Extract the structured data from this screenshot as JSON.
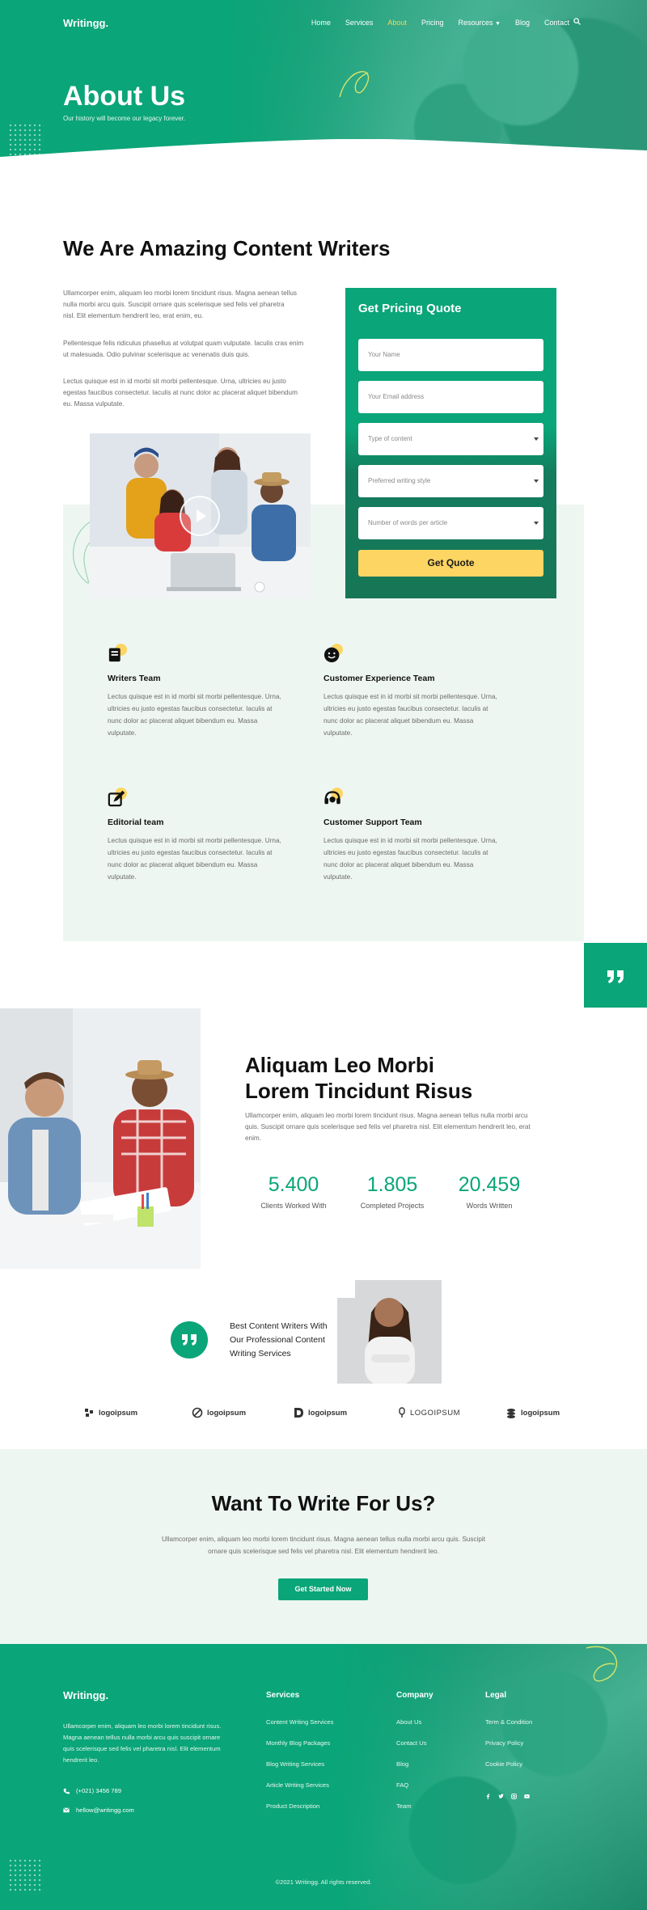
{
  "header": {
    "logo": "Writingg.",
    "nav": [
      {
        "label": "Home",
        "active": false
      },
      {
        "label": "Services",
        "active": false
      },
      {
        "label": "About",
        "active": true
      },
      {
        "label": "Pricing",
        "active": false
      },
      {
        "label": "Resources",
        "active": false,
        "dropdown": true
      },
      {
        "label": "Blog",
        "active": false
      },
      {
        "label": "Contact",
        "active": false
      }
    ],
    "search_icon": "search-icon"
  },
  "hero": {
    "title": "About Us",
    "subtitle": "Our history will become our legacy forever."
  },
  "intro": {
    "title": "We Are Amazing Content Writers",
    "paragraphs": [
      "Ullamcorper enim, aliquam leo morbi lorem tincidunt risus. Magna aenean tellus nulla morbi arcu quis. Suscipit ornare quis scelerisque sed felis vel pharetra nisl. Elit elementum hendrerit leo, erat enim, eu.",
      "Pellentesque felis ridiculus phasellus at volutpat quam vulputate. Iaculis cras enim ut malesuada. Odio pulvinar scelerisque ac venenatis duis quis.",
      "Lectus quisque est in id morbi sit morbi pellentesque. Urna, ultricies eu justo egestas faucibus consectetur. Iaculis at nunc dolor ac placerat aliquet bibendum eu. Massa vulputate."
    ]
  },
  "quote_form": {
    "title": "Get Pricing Quote",
    "name_placeholder": "Your Name",
    "email_placeholder": "Your Email address",
    "content_type": "Type of content",
    "writing_style": "Preferred writing style",
    "word_count": "Number of words per article",
    "submit_label": "Get Quote"
  },
  "teams": [
    {
      "icon": "book-icon",
      "title": "Writers Team",
      "text": "Lectus quisque est in id morbi sit morbi pellentesque. Urna, ultricies eu justo egestas faucibus consectetur. Iaculis at nunc dolor ac placerat aliquet bibendum eu. Massa vulputate."
    },
    {
      "icon": "smiley-icon",
      "title": "Customer Experience Team",
      "text": "Lectus quisque est in id morbi sit morbi pellentesque. Urna, ultricies eu justo egestas faucibus consectetur. Iaculis at nunc dolor ac placerat aliquet bibendum eu. Massa vulputate."
    },
    {
      "icon": "edit-icon",
      "title": "Editorial team",
      "text": "Lectus quisque est in id morbi sit morbi pellentesque. Urna, ultricies eu justo egestas faucibus consectetur. Iaculis at nunc dolor ac placerat aliquet bibendum eu. Massa vulputate."
    },
    {
      "icon": "headset-icon",
      "title": "Customer Support Team",
      "text": "Lectus quisque est in id morbi sit morbi pellentesque. Urna, ultricies eu justo egestas faucibus consectetur. Iaculis at nunc dolor ac placerat aliquet bibendum eu. Massa vulputate."
    }
  ],
  "about2": {
    "title_line1": "Aliquam Leo Morbi",
    "title_line2": "Lorem Tincidunt Risus",
    "text": "Ullamcorper enim, aliquam leo morbi lorem tincidunt risus. Magna aenean tellus nulla morbi arcu quis. Suscipit ornare quis scelerisque sed felis vel pharetra nisl. Elit elementum hendrerit leo, erat enim.",
    "stats": [
      {
        "value": "5.400",
        "label": "Clients Worked With"
      },
      {
        "value": "1.805",
        "label": "Completed Projects"
      },
      {
        "value": "20.459",
        "label": "Words Written"
      }
    ]
  },
  "testimonial": {
    "text": "Best Content Writers With Our Professional Content Writing Services"
  },
  "logos": [
    "logoipsum",
    "logoipsum",
    "logoipsum",
    "LOGOIPSUM",
    "logoipsum"
  ],
  "cta": {
    "title": "Want To Write For Us?",
    "text": "Ullamcorper enim, aliquam leo morbi lorem tincidunt risus. Magna aenean tellus nulla morbi arcu quis. Suscipit ornare quis scelerisque sed felis vel pharetra nisl. Elit elementum hendrerit leo.",
    "button": "Get Started Now"
  },
  "footer": {
    "logo": "Writingg.",
    "about": "Ullamcorper enim, aliquam leo morbi lorem tincidunt risus. Magna aenean tellus nulla morbi arcu quis suscipit ornare quis scelerisque sed felis vel pharetra nisl. Elit elementum hendrerit leo.",
    "phone": "(+021) 3456 789",
    "email": "hellow@writingg.com",
    "columns": [
      {
        "title": "Services",
        "links": [
          "Content Writing Services",
          "Monthly Blog Packages",
          "Blog Writing Services",
          "Article Writing Services",
          "Product Description"
        ]
      },
      {
        "title": "Company",
        "links": [
          "About Us",
          "Contact Us",
          "Blog",
          "FAQ",
          "Team"
        ]
      },
      {
        "title": "Legal",
        "links": [
          "Term & Condition",
          "Privacy Policy",
          "Cookie Policy"
        ]
      }
    ],
    "socials": [
      "facebook-icon",
      "twitter-icon",
      "instagram-icon",
      "youtube-icon"
    ],
    "copyright": "©2021 Writingg. All rights reserved."
  },
  "colors": {
    "primary": "#0aa578",
    "accent": "#fdd563",
    "mint": "#eef6f2"
  }
}
